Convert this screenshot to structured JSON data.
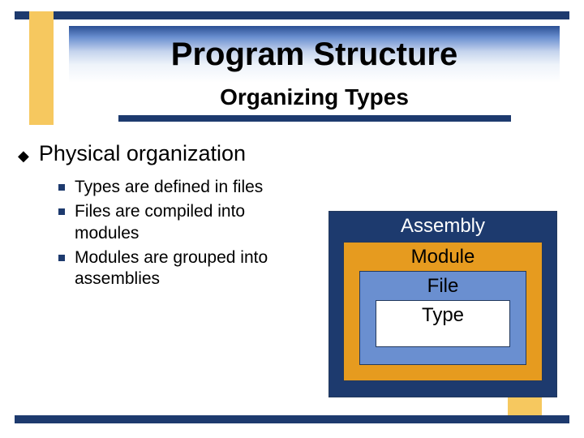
{
  "title": "Program Structure",
  "subtitle": "Organizing Types",
  "heading": "Physical organization",
  "items": [
    "Types are defined in files",
    "Files are compiled into modules",
    "Modules are grouped into assemblies"
  ],
  "boxes": {
    "assembly": "Assembly",
    "module": "Module",
    "file": "File",
    "type": "Type"
  }
}
